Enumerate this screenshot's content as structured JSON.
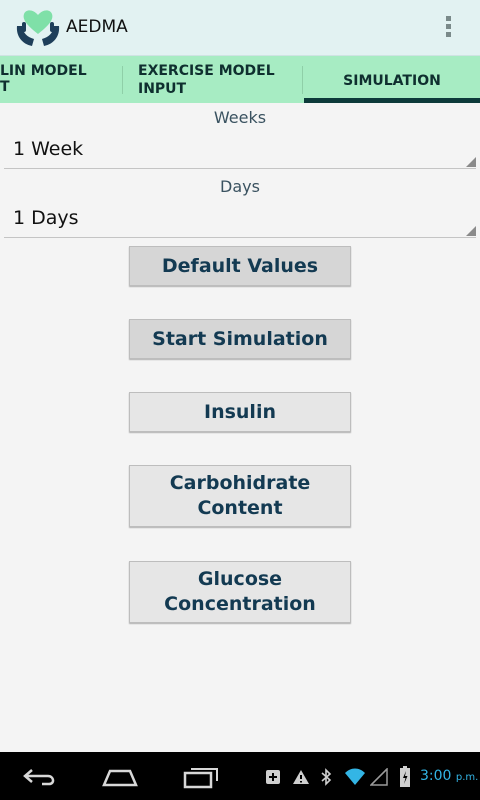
{
  "app": {
    "title": "AEDMA"
  },
  "tabs": [
    {
      "label_line1": "LIN MODEL",
      "label_line2": "T"
    },
    {
      "label_line1": "EXERCISE MODEL",
      "label_line2": "INPUT"
    },
    {
      "label": "SIMULATION"
    }
  ],
  "weeks": {
    "label": "Weeks",
    "value": "1 Week"
  },
  "days": {
    "label": "Days",
    "value": "1 Days"
  },
  "buttons": {
    "default_values": "Default Values",
    "start_simulation": "Start Simulation",
    "insulin": "Insulin",
    "carbohydrate_line1": "Carbohidrate",
    "carbohydrate_line2": "Content",
    "glucose_line1": "Glucose",
    "glucose_line2": "Concentration"
  },
  "status": {
    "time": "3:00",
    "ampm": "p.m."
  },
  "colors": {
    "actionbar": "#e2f2f2",
    "tabs": "#a7ecc3",
    "tab_indicator": "#0d3a3a",
    "button_text": "#133a52",
    "clock": "#33b5e5",
    "logo_heart": "#7fe0a8",
    "logo_hands": "#1e3f5a"
  },
  "icons": [
    "app-logo-icon",
    "overflow-menu-icon",
    "spinner-arrow-icon",
    "back-icon",
    "home-icon",
    "recent-apps-icon",
    "notification-plus-icon",
    "warning-icon",
    "bluetooth-icon",
    "wifi-icon",
    "signal-icon",
    "battery-icon"
  ]
}
